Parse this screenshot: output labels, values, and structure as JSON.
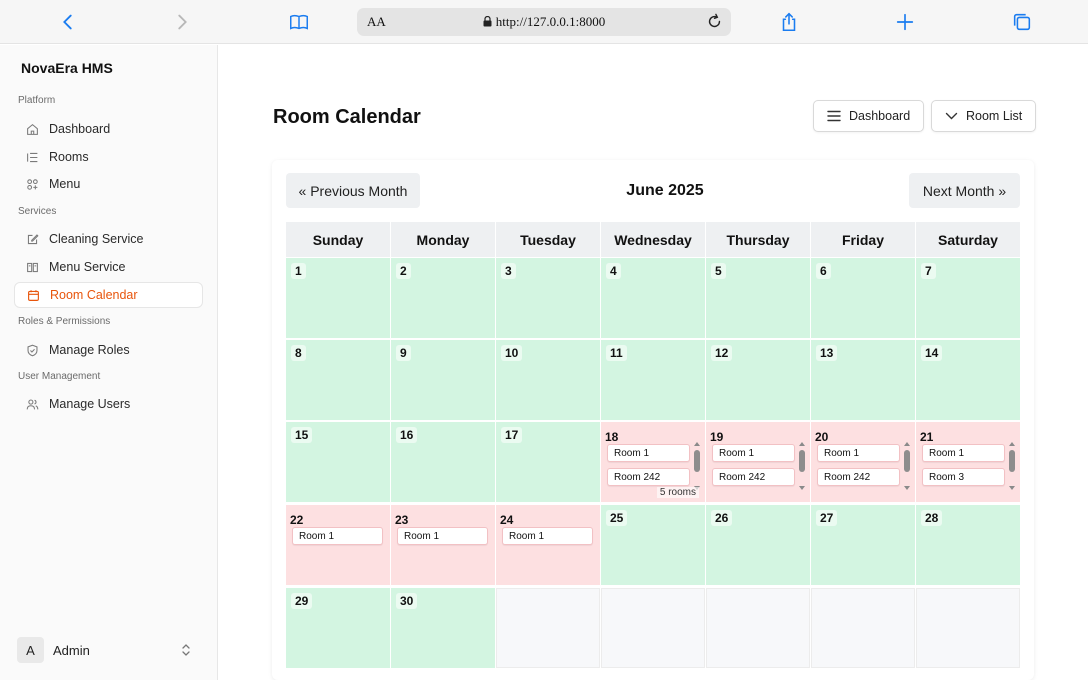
{
  "browser": {
    "url": "http://127.0.0.1:8000",
    "aa_label": "AA"
  },
  "sidebar": {
    "brand": "NovaEra HMS",
    "groups": [
      {
        "label": "Platform",
        "items": [
          {
            "label": "Dashboard",
            "icon": "home-icon"
          },
          {
            "label": "Rooms",
            "icon": "list-icon"
          },
          {
            "label": "Menu",
            "icon": "grid-icon"
          }
        ]
      },
      {
        "label": "Services",
        "items": [
          {
            "label": "Cleaning Service",
            "icon": "edit-icon"
          },
          {
            "label": "Menu Service",
            "icon": "menu-service-icon"
          },
          {
            "label": "Room Calendar",
            "icon": "calendar-icon",
            "active": true
          }
        ]
      },
      {
        "label": "Roles & Permissions",
        "items": [
          {
            "label": "Manage Roles",
            "icon": "shield-icon"
          }
        ]
      },
      {
        "label": "User Management",
        "items": [
          {
            "label": "Manage Users",
            "icon": "users-icon"
          }
        ]
      }
    ],
    "user": {
      "initial": "A",
      "name": "Admin"
    }
  },
  "main": {
    "title": "Room Calendar",
    "dashboard_button": "Dashboard",
    "room_list_button": "Room List"
  },
  "calendar": {
    "prev_label": "« Previous Month",
    "next_label": "Next Month »",
    "month_title": "June 2025",
    "weekdays": [
      "Sunday",
      "Monday",
      "Tuesday",
      "Wednesday",
      "Thursday",
      "Friday",
      "Saturday"
    ],
    "days": [
      {
        "day": "1",
        "status": "available"
      },
      {
        "day": "2",
        "status": "available"
      },
      {
        "day": "3",
        "status": "available"
      },
      {
        "day": "4",
        "status": "available"
      },
      {
        "day": "5",
        "status": "available"
      },
      {
        "day": "6",
        "status": "available"
      },
      {
        "day": "7",
        "status": "available"
      },
      {
        "day": "8",
        "status": "available"
      },
      {
        "day": "9",
        "status": "available"
      },
      {
        "day": "10",
        "status": "available"
      },
      {
        "day": "11",
        "status": "available"
      },
      {
        "day": "12",
        "status": "available"
      },
      {
        "day": "13",
        "status": "available"
      },
      {
        "day": "14",
        "status": "available"
      },
      {
        "day": "15",
        "status": "available"
      },
      {
        "day": "16",
        "status": "available"
      },
      {
        "day": "17",
        "status": "available"
      },
      {
        "day": "18",
        "status": "booked",
        "rooms": [
          "Room 1",
          "Room 242"
        ],
        "count": "5 rooms",
        "scroll": true
      },
      {
        "day": "19",
        "status": "booked",
        "rooms": [
          "Room 1",
          "Room 242"
        ],
        "scroll": true
      },
      {
        "day": "20",
        "status": "booked",
        "rooms": [
          "Room 1",
          "Room 242"
        ],
        "scroll": true
      },
      {
        "day": "21",
        "status": "booked",
        "rooms": [
          "Room 1",
          "Room 3"
        ],
        "scroll": true
      },
      {
        "day": "22",
        "status": "booked",
        "rooms": [
          "Room 1"
        ]
      },
      {
        "day": "23",
        "status": "booked",
        "rooms": [
          "Room 1"
        ]
      },
      {
        "day": "24",
        "status": "booked",
        "rooms": [
          "Room 1"
        ]
      },
      {
        "day": "25",
        "status": "available"
      },
      {
        "day": "26",
        "status": "available"
      },
      {
        "day": "27",
        "status": "available"
      },
      {
        "day": "28",
        "status": "available"
      },
      {
        "day": "29",
        "status": "available"
      },
      {
        "day": "30",
        "status": "available"
      },
      {
        "day": "",
        "status": "empty"
      },
      {
        "day": "",
        "status": "empty"
      },
      {
        "day": "",
        "status": "empty"
      },
      {
        "day": "",
        "status": "empty"
      },
      {
        "day": "",
        "status": "empty"
      }
    ]
  },
  "colors": {
    "accent": "#e8550c",
    "available": "#d3f5e1",
    "booked": "#fde0e1",
    "browser_blue": "#1a7cf0"
  }
}
